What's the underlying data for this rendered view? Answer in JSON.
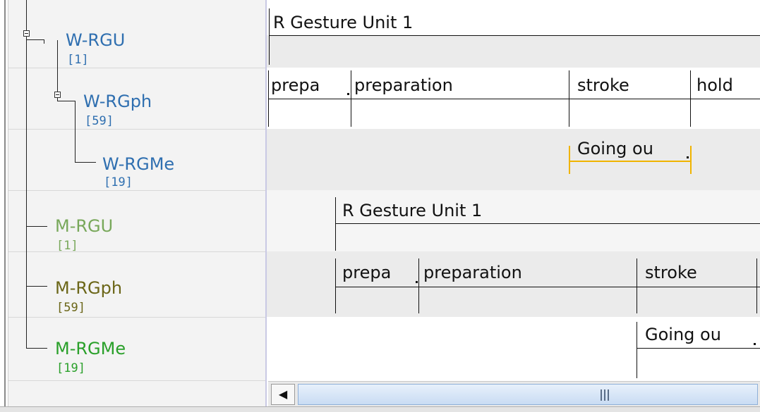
{
  "tiers": [
    {
      "name": "W-RGU",
      "count": "[1]",
      "name_color": "#2f6fb0",
      "count_color": "#2f6fb0"
    },
    {
      "name": "W-RGph",
      "count": "[59]",
      "name_color": "#2f6fb0",
      "count_color": "#2f6fb0"
    },
    {
      "name": "W-RGMe",
      "count": "[19]",
      "name_color": "#2f6fb0",
      "count_color": "#2f6fb0"
    },
    {
      "name": "M-RGU",
      "count": "[1]",
      "name_color": "#78a85a",
      "count_color": "#78a85a"
    },
    {
      "name": "M-RGph",
      "count": "[59]",
      "name_color": "#6b6618",
      "count_color": "#6b6618"
    },
    {
      "name": "M-RGMe",
      "count": "[19]",
      "name_color": "#2aa02a",
      "count_color": "#2aa02a"
    }
  ],
  "annotations": {
    "w_rgu": [
      "R Gesture Unit 1"
    ],
    "w_rgph": [
      "prepa",
      "preparation",
      "stroke",
      "hold"
    ],
    "w_rgme": [
      "Going ou"
    ],
    "m_rgu": [
      "R Gesture Unit 1"
    ],
    "m_rgph": [
      "prepa",
      "preparation",
      "stroke"
    ],
    "m_rgme": [
      "Going ou"
    ]
  },
  "colors": {
    "selected_annotation": "#f0b400",
    "panel_background": "#f3f3f3",
    "scroll_thumb": "#c9dcf3"
  },
  "scrollbar": {
    "left_arrow": "◀",
    "grip_icon": "grip-lines-icon"
  }
}
